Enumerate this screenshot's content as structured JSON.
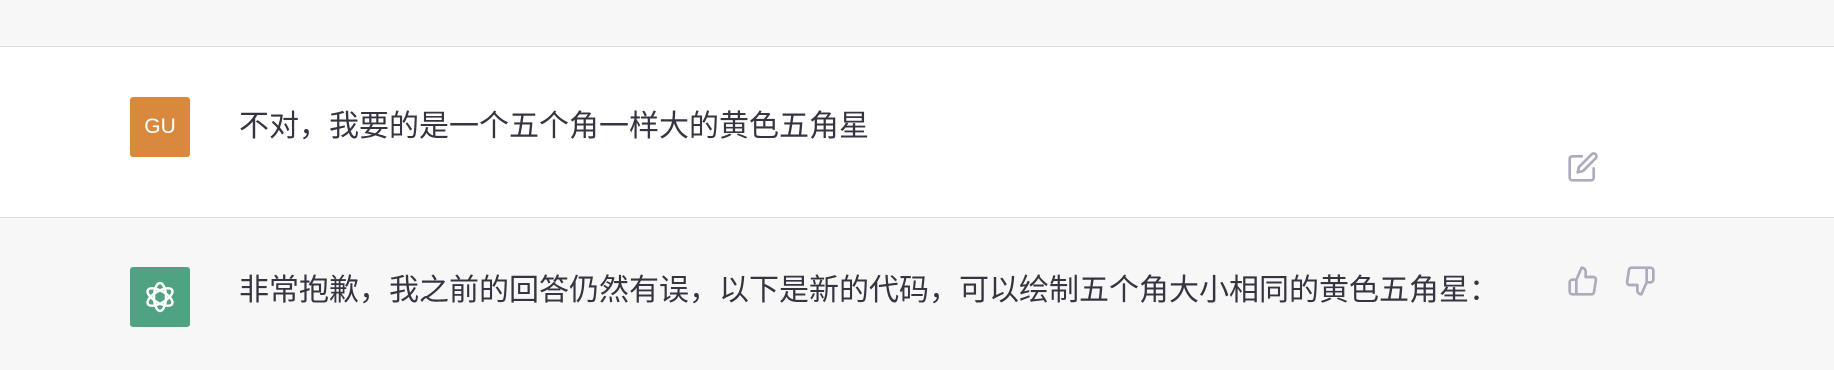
{
  "user_message": {
    "avatar_initials": "GU",
    "text": "不对，我要的是一个五个角一样大的黄色五角星",
    "edit_icon": "edit-icon"
  },
  "assistant_message": {
    "avatar_icon": "openai-logo",
    "text": "非常抱歉，我之前的回答仍然有误，以下是新的代码，可以绘制五个角大小相同的黄色五角星：",
    "thumbs_up_icon": "thumbs-up-icon",
    "thumbs_down_icon": "thumbs-down-icon"
  },
  "colors": {
    "user_avatar": "#d8893d",
    "assistant_avatar": "#4fa383",
    "icon_gray": "#acacbe",
    "background_light": "#f7f7f8"
  }
}
